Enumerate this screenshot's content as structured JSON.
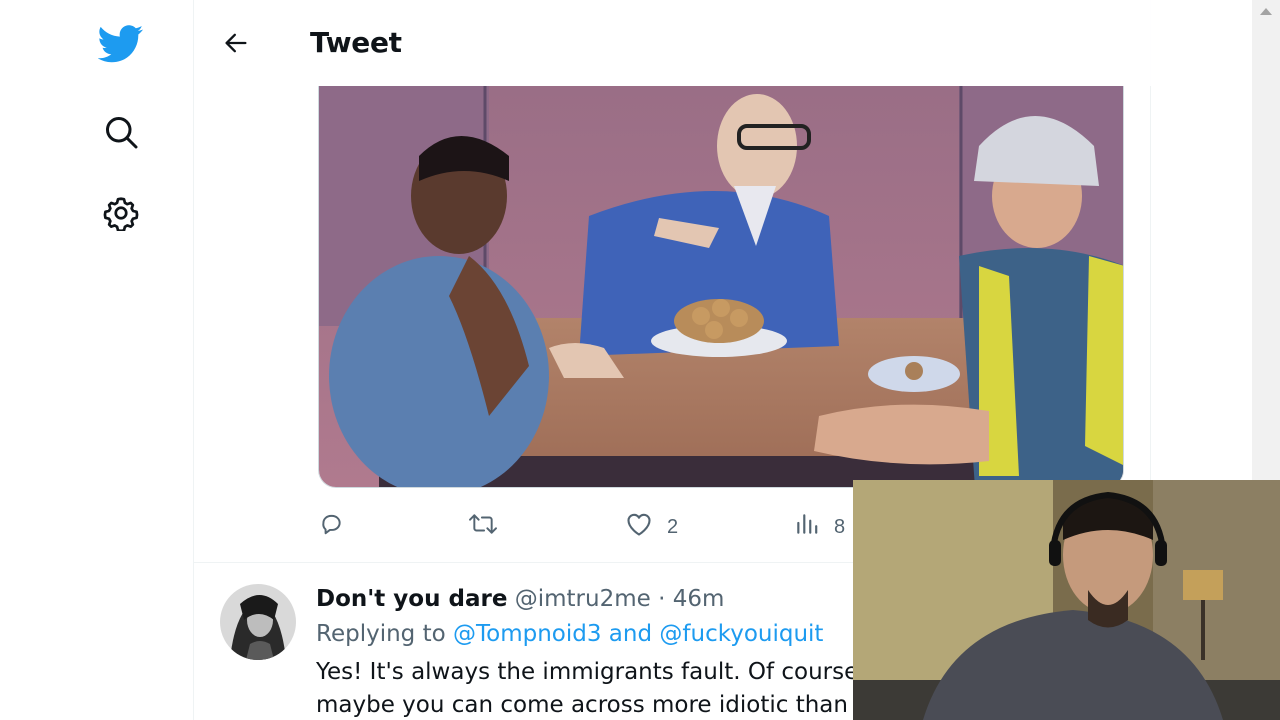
{
  "header": {
    "title": "Tweet"
  },
  "nav": {
    "icons": [
      "twitter-bird-icon",
      "search-icon",
      "settings-gear-icon"
    ]
  },
  "tweet_actions": {
    "likes": "2",
    "views_partial": "8"
  },
  "reply": {
    "name": "Don't you dare",
    "handle": "@imtru2me",
    "separator": "·",
    "time": "46m",
    "replying_prefix": "Replying to",
    "mention_1": "@Tompnoid3",
    "mention_joiner": "and",
    "mention_2": "@fuckyouiquit",
    "line_1": "Yes! It's always the immigrants fault. Of course",
    "line_2": "maybe you can come across more idiotic than thi"
  },
  "colors": {
    "accent": "#1d9bf0",
    "secondary_text": "#536471",
    "border": "#eff3f4"
  }
}
